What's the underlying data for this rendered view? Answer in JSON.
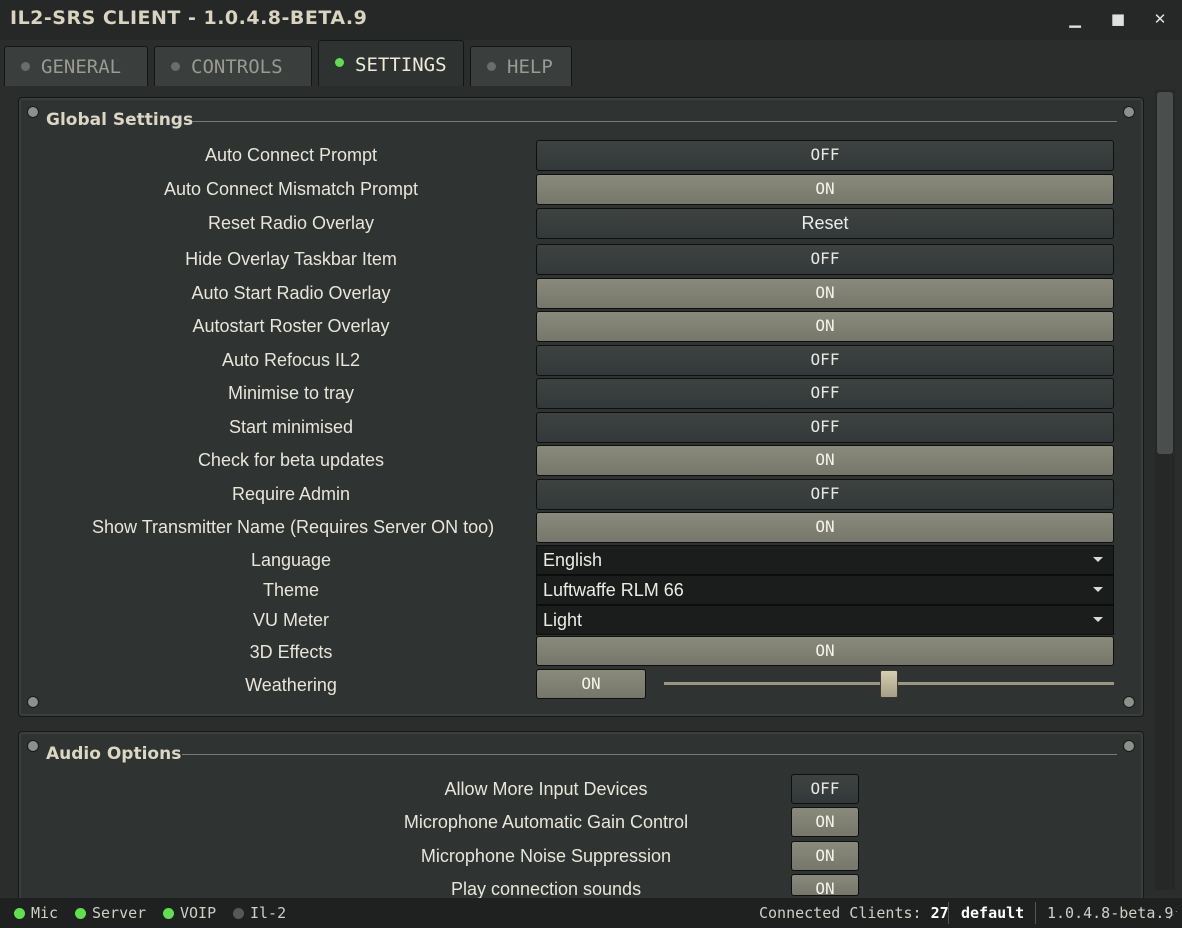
{
  "window": {
    "title": "IL2-SRS CLIENT - 1.0.4.8-BETA.9",
    "minimize_icon": "minimize-icon",
    "maximize_icon": "maximize-icon",
    "close_icon": "close-icon",
    "minimize_glyph": "▁",
    "maximize_glyph": "■",
    "close_glyph": "✕"
  },
  "tabs": [
    {
      "label": "GENERAL",
      "active": false
    },
    {
      "label": "CONTROLS",
      "active": false
    },
    {
      "label": "SETTINGS",
      "active": true
    },
    {
      "label": "HELP",
      "active": false
    }
  ],
  "global_settings": {
    "title": "Global Settings",
    "rows": [
      {
        "label": "Auto Connect Prompt",
        "value": "OFF",
        "state": "off"
      },
      {
        "label": "Auto Connect Mismatch Prompt",
        "value": "ON",
        "state": "on"
      },
      {
        "label": "Reset Radio Overlay",
        "value": "Reset",
        "state": "neutral"
      },
      {
        "label": "Hide Overlay Taskbar Item",
        "value": "OFF",
        "state": "off"
      },
      {
        "label": "Auto Start Radio Overlay",
        "value": "ON",
        "state": "on"
      },
      {
        "label": "Autostart Roster Overlay",
        "value": "ON",
        "state": "on"
      },
      {
        "label": "Auto Refocus IL2",
        "value": "OFF",
        "state": "off"
      },
      {
        "label": "Minimise to tray",
        "value": "OFF",
        "state": "off"
      },
      {
        "label": "Start minimised",
        "value": "OFF",
        "state": "off"
      },
      {
        "label": "Check for beta updates",
        "value": "ON",
        "state": "on"
      },
      {
        "label": "Require Admin",
        "value": "OFF",
        "state": "off"
      },
      {
        "label": "Show Transmitter Name (Requires Server ON too)",
        "value": "ON",
        "state": "on"
      }
    ],
    "language": {
      "label": "Language",
      "value": "English"
    },
    "theme": {
      "label": "Theme",
      "value": "Luftwaffe RLM 66"
    },
    "vu_meter": {
      "label": "VU Meter",
      "value": "Light"
    },
    "effects_3d": {
      "label": "3D Effects",
      "value": "ON",
      "state": "on"
    },
    "weathering": {
      "label": "Weathering",
      "value": "ON",
      "slider_fraction": 0.5
    }
  },
  "audio_options": {
    "title": "Audio Options",
    "rows": [
      {
        "label": "Allow More Input Devices",
        "value": "OFF",
        "state": "off"
      },
      {
        "label": "Microphone Automatic Gain Control",
        "value": "ON",
        "state": "on"
      },
      {
        "label": "Microphone Noise Suppression",
        "value": "ON",
        "state": "on"
      },
      {
        "label": "Play connection sounds",
        "value": "ON",
        "state": "on"
      }
    ]
  },
  "status_bar": {
    "indicators": [
      {
        "label": "Mic",
        "color": "#5fe04f"
      },
      {
        "label": "Server",
        "color": "#5fe04f"
      },
      {
        "label": "VOIP",
        "color": "#5fe04f"
      },
      {
        "label": "Il-2",
        "color": "#555855"
      }
    ],
    "connected_label": "Connected Clients:",
    "connected_count": "27",
    "profile": "default",
    "version": "1.0.4.8-beta.9"
  },
  "colors": {
    "on_button": "#7f7f72",
    "off_button": "#3a3f3d",
    "active_led": "#5fe04f",
    "inactive_led": "#555855"
  }
}
